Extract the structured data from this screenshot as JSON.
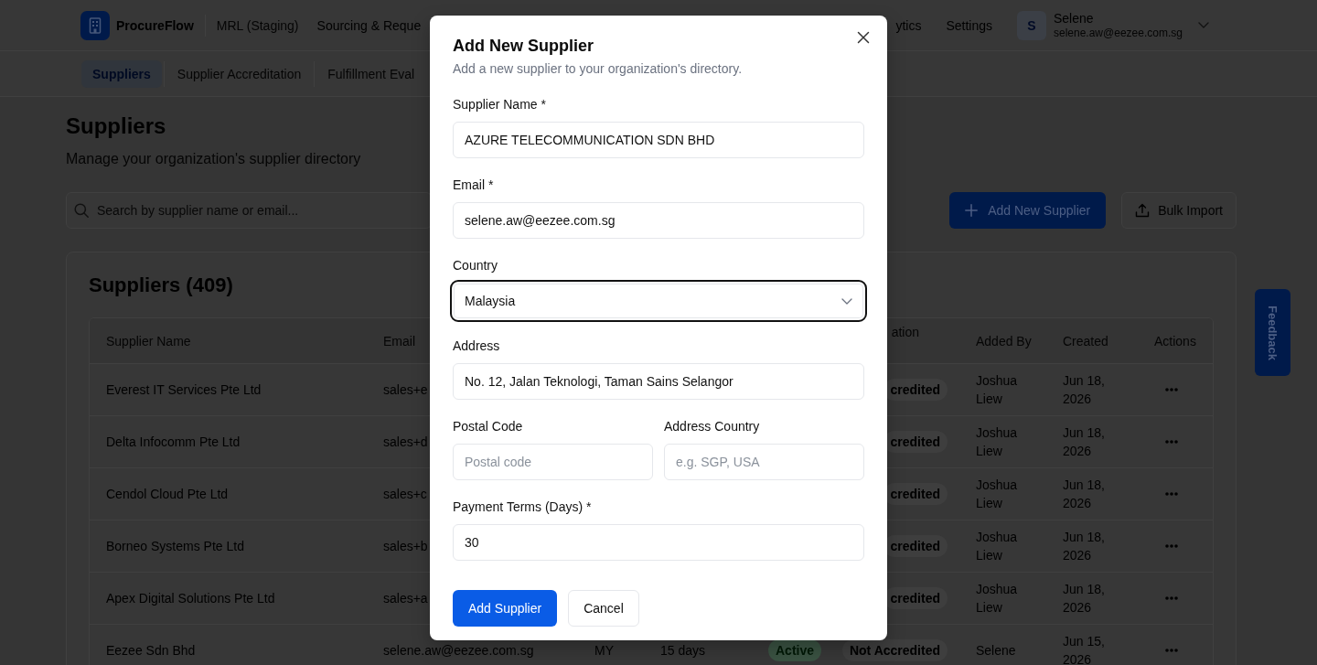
{
  "header": {
    "app_name": "ProcureFlow",
    "workspace": "MRL (Staging)",
    "nav_left": [
      "Sourcing & Reque"
    ],
    "nav_right": [
      "ytics",
      "Settings"
    ],
    "user": {
      "initial": "S",
      "name": "Selene",
      "email": "selene.aw@eezee.com.sg"
    }
  },
  "subnav": [
    {
      "label": "Suppliers",
      "selected": true
    },
    {
      "label": "Supplier Accreditation",
      "selected": false
    },
    {
      "label": "Fulfillment Eval",
      "selected": false
    }
  ],
  "page": {
    "title": "Suppliers",
    "subtitle": "Manage your organization's supplier directory",
    "search": {
      "placeholder": "Search by supplier name or email..."
    },
    "buttons": [
      {
        "label": "Add New Supplier",
        "kind": "primary"
      },
      {
        "label": "Bulk Import",
        "kind": "secondary"
      }
    ]
  },
  "card": {
    "title": "Suppliers (409)",
    "table": {
      "header": {
        "supplier_name": "Supplier Name",
        "email": "Email",
        "column_6": "ation",
        "added_by": "Added By",
        "created": "Created",
        "actions": "Actions"
      },
      "rows": [
        {
          "supplier_name": "Everest IT Services Pte Ltd",
          "email": "sales+e",
          "column_6": "credited",
          "added_by": "Joshua Liew",
          "created": "Jun 18, 2026"
        },
        {
          "supplier_name": "Delta Infocomm Pte Ltd",
          "email": "sales+d",
          "column_6": "credited",
          "added_by": "Joshua Liew",
          "created": "Jun 18, 2026"
        },
        {
          "supplier_name": "Cendol Cloud Pte Ltd",
          "email": "sales+c",
          "column_6": "credited",
          "added_by": "Joshua Liew",
          "created": "Jun 18, 2026"
        },
        {
          "supplier_name": "Borneo Systems Pte Ltd",
          "email": "sales+b",
          "column_6": "credited",
          "added_by": "Joshua Liew",
          "created": "Jun 18, 2026"
        },
        {
          "supplier_name": "Apex Digital Solutions Pte Ltd",
          "email": "sales+a",
          "column_6": "credited",
          "added_by": "Joshua Liew",
          "created": "Jun 18, 2026"
        },
        {
          "supplier_name": "Eezee Sdn Bhd",
          "email": "selene.aw@eezee.com.sg",
          "column_3": "MY",
          "column_4": "15 days",
          "column_5": "Active",
          "column_6": "Not Accredited",
          "added_by": "Selene",
          "created": "Jun 15, 2026"
        }
      ]
    }
  },
  "feedback": {
    "label": "Feedback"
  },
  "dialog": {
    "title": "Add New Supplier",
    "subtitle": "Add a new supplier to your organization's directory.",
    "fields": [
      {
        "kind": "text",
        "label": "Supplier Name *",
        "value": "AZURE TELECOMMUNICATION SDN BHD",
        "focused": false
      },
      {
        "kind": "text",
        "label": "Email *",
        "value": "selene.aw@eezee.com.sg",
        "focused": false
      },
      {
        "kind": "select",
        "label": "Country",
        "value": "Malaysia",
        "focused": true
      },
      {
        "kind": "text",
        "label": "Address",
        "value": "No. 12, Jalan Teknologi, Taman Sains Selangor",
        "focused": false
      },
      {
        "kind": "pair",
        "fields": [
          {
            "kind": "text",
            "label": "Postal Code",
            "placeholder": "Postal code",
            "focused": false
          },
          {
            "kind": "text",
            "label": "Address Country",
            "placeholder": "e.g. SGP, USA",
            "focused": false
          }
        ]
      },
      {
        "kind": "text",
        "label": "Payment Terms (Days) *",
        "value": "30",
        "focused": false
      }
    ],
    "buttons": [
      {
        "label": "Add Supplier",
        "kind": "primary"
      },
      {
        "label": "Cancel",
        "kind": "secondary"
      }
    ]
  }
}
